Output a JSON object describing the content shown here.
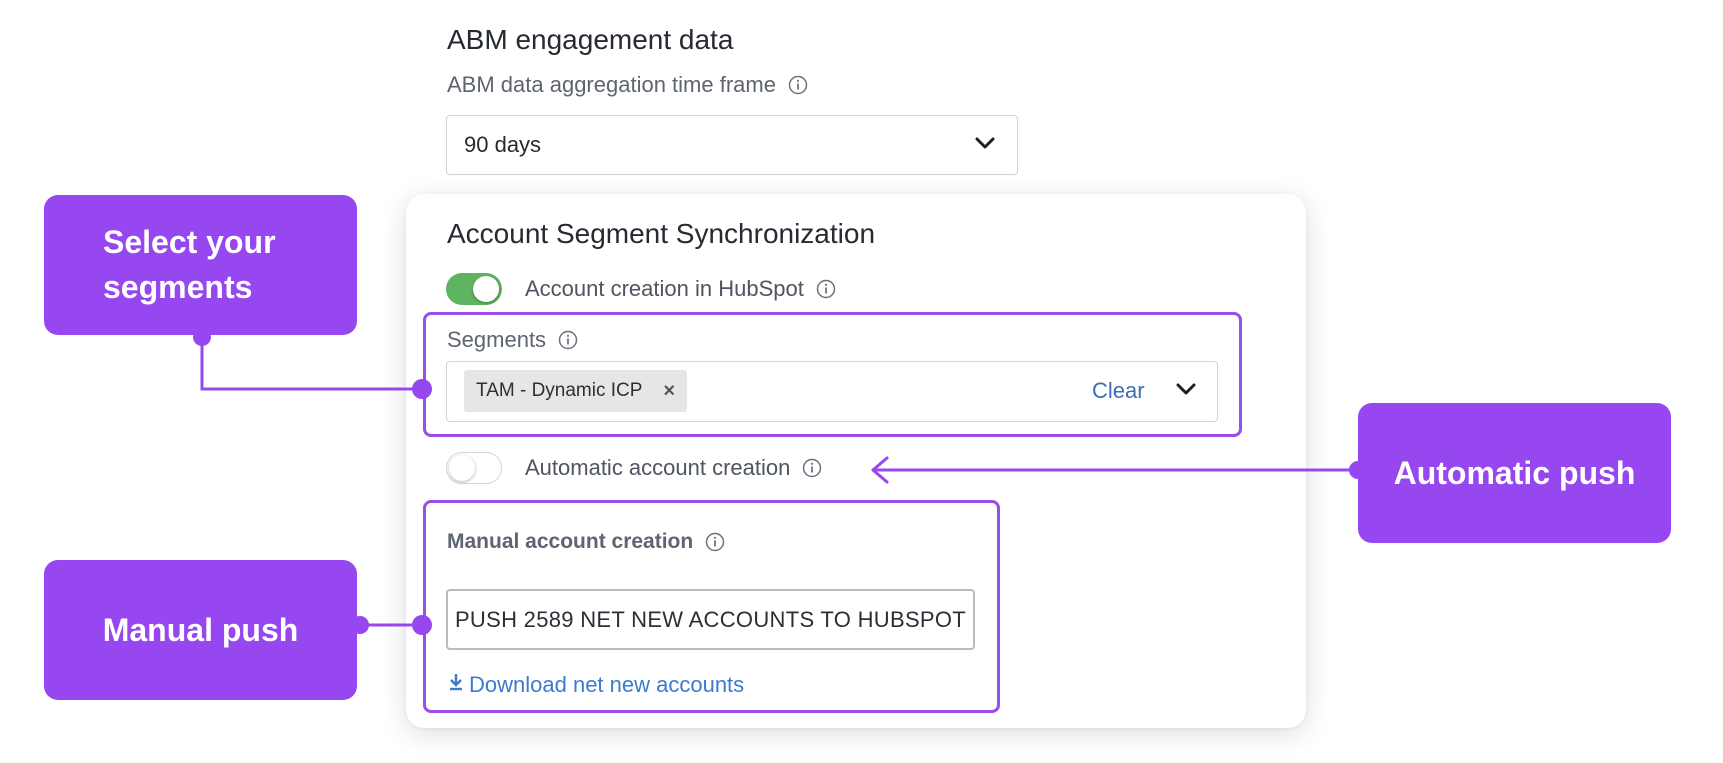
{
  "abm": {
    "title": "ABM engagement data",
    "timeframe_label": "ABM data aggregation time frame",
    "timeframe_value": "90 days"
  },
  "sync": {
    "title": "Account Segment Synchronization",
    "hubspot_toggle_label": "Account creation in HubSpot",
    "hubspot_toggle_on": true,
    "segments_label": "Segments",
    "selected_segment": "TAM - Dynamic ICP",
    "chip_remove": "×",
    "clear_label": "Clear",
    "auto_toggle_label": "Automatic account creation",
    "auto_toggle_on": false,
    "manual_label": "Manual account creation",
    "push_button_label": "PUSH 2589 NET NEW ACCOUNTS TO HUBSPOT",
    "download_label": "Download net new accounts"
  },
  "callouts": {
    "segments_line1": "Select your",
    "segments_line2": "segments",
    "manual": "Manual push",
    "automatic": "Automatic push"
  },
  "colors": {
    "accent_purple": "#9747ef",
    "toggle_on": "#5fb460",
    "link_blue": "#3a7bd0"
  },
  "icons": {
    "info": "info-icon",
    "chevron": "chevron-down-icon",
    "download": "download-icon"
  }
}
